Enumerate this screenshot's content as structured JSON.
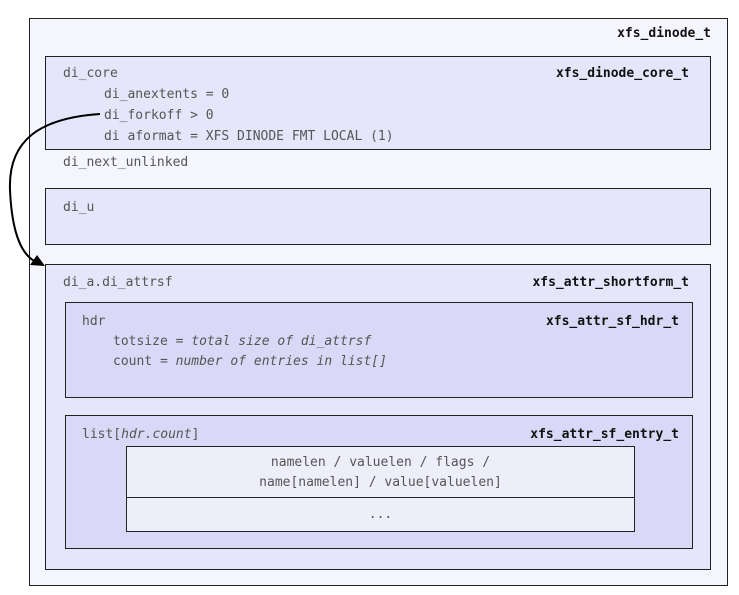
{
  "outer": {
    "type_name": "xfs_dinode_t"
  },
  "core": {
    "field": "di_core",
    "type_name": "xfs_dinode_core_t",
    "lines": [
      "di_anextents = 0",
      "di_forkoff > 0",
      "di aformat = XFS DINODE FMT LOCAL (1)"
    ]
  },
  "next_unlinked": "di_next_unlinked",
  "di_u": {
    "field": "di_u"
  },
  "attr": {
    "field": "di_a.di_attrsf",
    "type_name": "xfs_attr_shortform_t",
    "hdr": {
      "field": "hdr",
      "type_name": "xfs_attr_sf_hdr_t",
      "totsize_prefix": "totsize = ",
      "totsize_value": "total size of di_attrsf",
      "count_prefix": "count = ",
      "count_value": "number of entries in list[]"
    },
    "list": {
      "field_prefix": "list[",
      "field_index": "hdr.count",
      "field_suffix": "]",
      "type_name": "xfs_attr_sf_entry_t",
      "entry_line1": "namelen / valuelen / flags /",
      "entry_line2": "name[namelen] / value[valuelen]",
      "more": "..."
    }
  }
}
